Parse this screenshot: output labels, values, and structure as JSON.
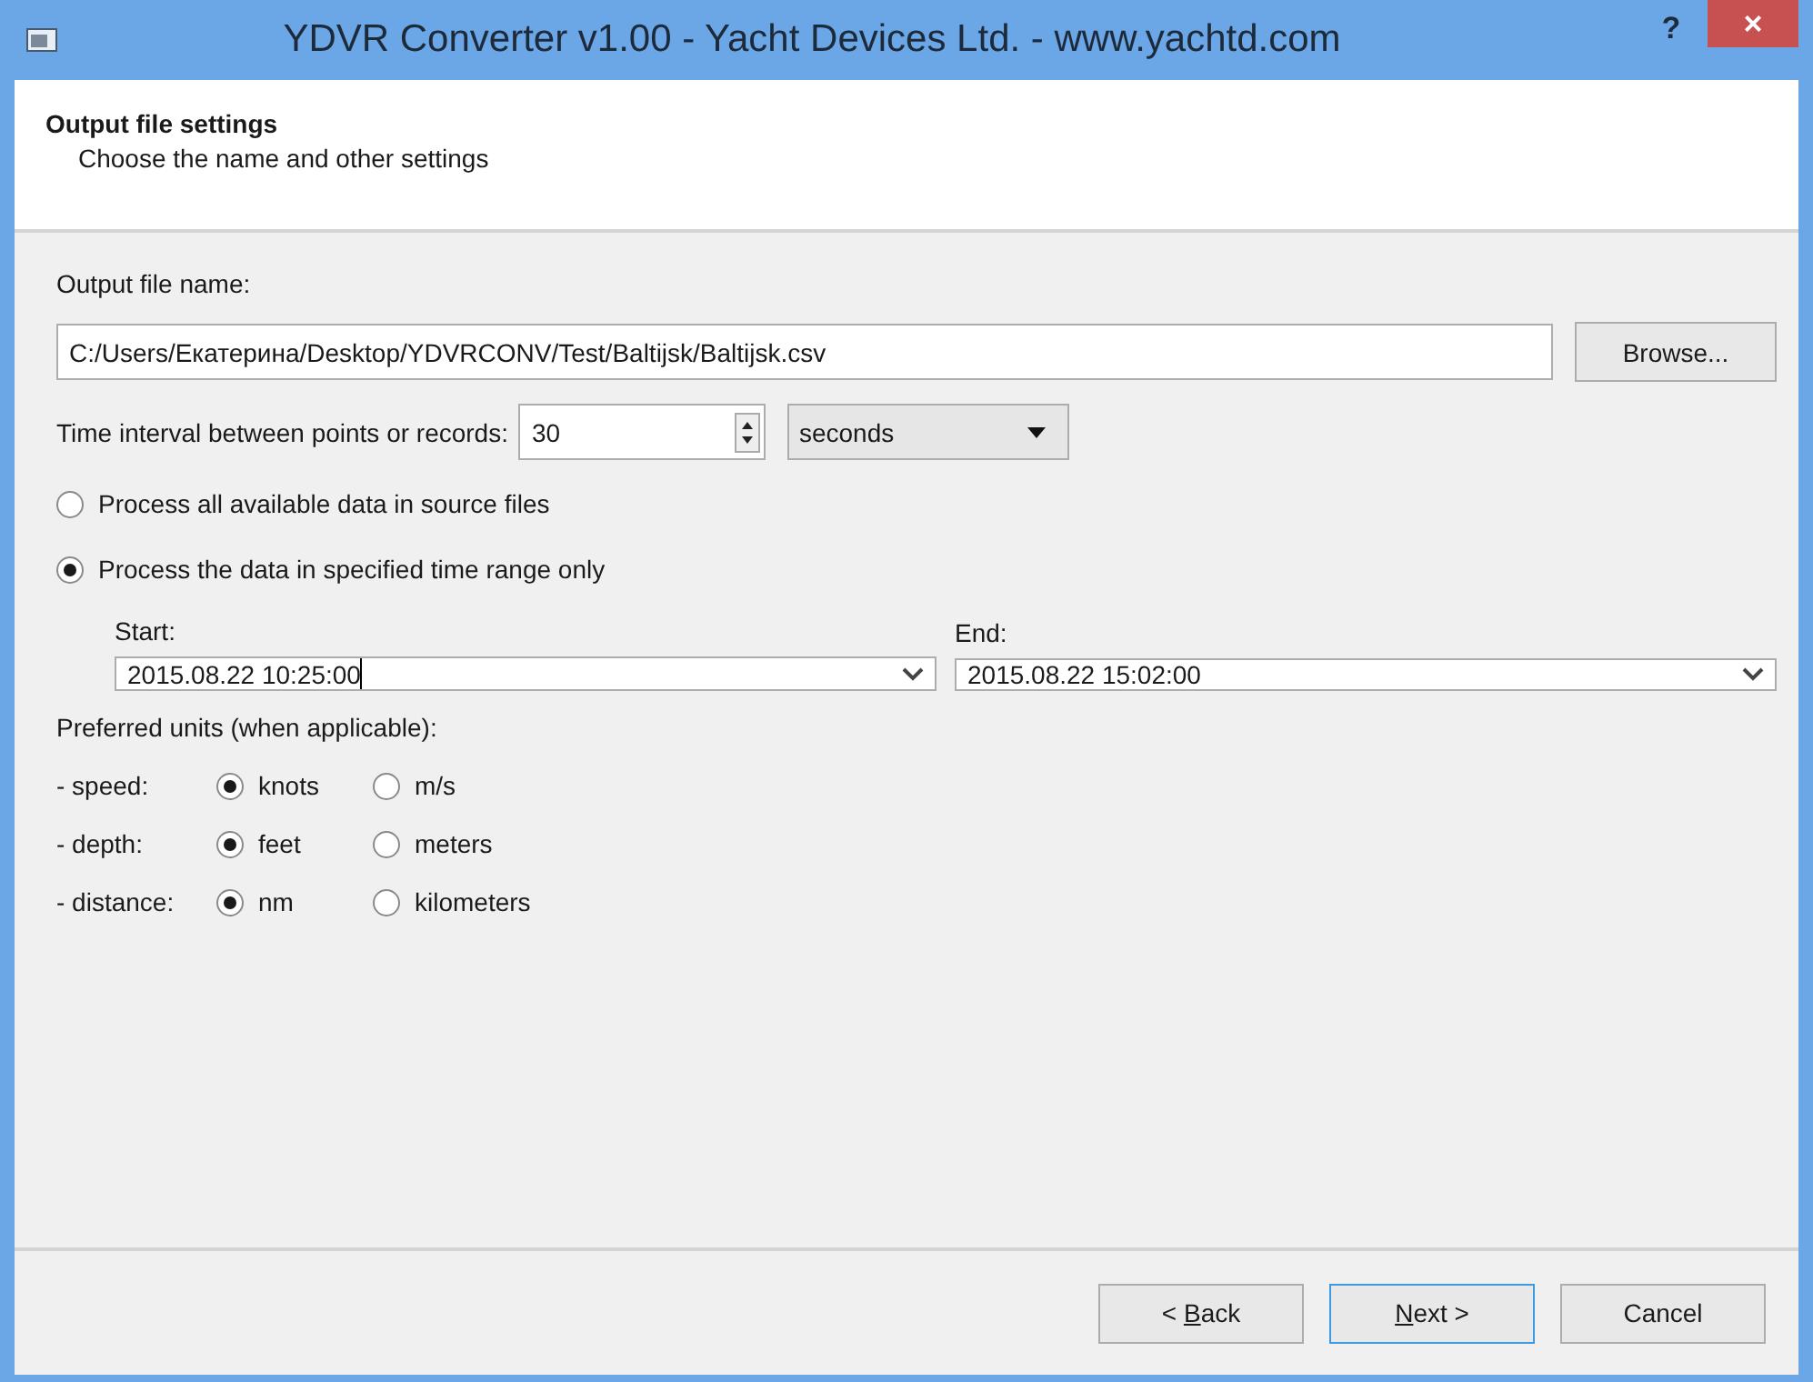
{
  "window": {
    "title": "YDVR Converter v1.00 - Yacht Devices Ltd. - www.yachtd.com",
    "help": "?",
    "close": "×"
  },
  "header": {
    "title": "Output file settings",
    "subtitle": "Choose the name and other settings"
  },
  "output_file": {
    "label": "Output file name:",
    "value": "C:/Users/Екатерина/Desktop/YDVRCONV/Test/Baltijsk/Baltijsk.csv",
    "browse": "Browse..."
  },
  "interval": {
    "label": "Time interval between points or records:",
    "value": "30",
    "unit": "seconds"
  },
  "range_options": [
    {
      "label": "Process all available data in source files",
      "selected": false
    },
    {
      "label": "Process the data in specified time range only",
      "selected": true
    }
  ],
  "start": {
    "label": "Start:",
    "value": "2015.08.22 10:25:00",
    "focused": true
  },
  "end": {
    "label": "End:",
    "value": "2015.08.22 15:02:00",
    "focused": false
  },
  "units": {
    "label": "Preferred units (when applicable):",
    "rows": [
      {
        "label": "- speed:",
        "options": [
          {
            "label": "knots",
            "selected": true
          },
          {
            "label": "m/s",
            "selected": false
          }
        ]
      },
      {
        "label": "- depth:",
        "options": [
          {
            "label": "feet",
            "selected": true
          },
          {
            "label": "meters",
            "selected": false
          }
        ]
      },
      {
        "label": "- distance:",
        "options": [
          {
            "label": "nm",
            "selected": true
          },
          {
            "label": "kilometers",
            "selected": false
          }
        ]
      }
    ]
  },
  "buttons": [
    {
      "text": "< ",
      "mnemonic": "B",
      "rest": "ack",
      "default": false
    },
    {
      "mnemonic": "N",
      "rest": "ext >",
      "default": true
    },
    {
      "text": "Cancel",
      "default": false
    }
  ]
}
